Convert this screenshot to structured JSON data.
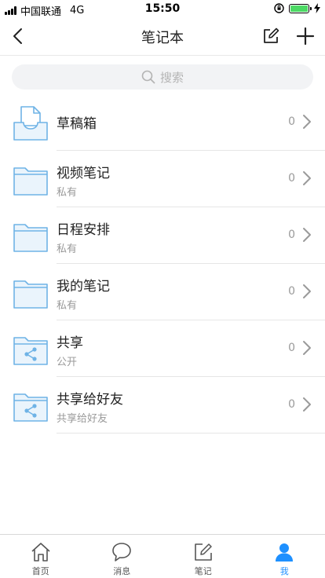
{
  "status_bar": {
    "carrier": "中国联通",
    "network": "4G",
    "time": "15:50"
  },
  "nav": {
    "title": "笔记本",
    "back_icon": "chevron-left-icon",
    "edit_icon": "edit-icon",
    "add_icon": "plus-icon"
  },
  "search": {
    "placeholder": "搜索"
  },
  "notebooks": [
    {
      "title": "草稿箱",
      "subtitle": "",
      "count": "0",
      "icon": "inbox-tray-icon"
    },
    {
      "title": "视频笔记",
      "subtitle": "私有",
      "count": "0",
      "icon": "folder-icon"
    },
    {
      "title": "日程安排",
      "subtitle": "私有",
      "count": "0",
      "icon": "folder-icon"
    },
    {
      "title": "我的笔记",
      "subtitle": "私有",
      "count": "0",
      "icon": "folder-icon"
    },
    {
      "title": "共享",
      "subtitle": "公开",
      "count": "0",
      "icon": "shared-folder-icon"
    },
    {
      "title": "共享给好友",
      "subtitle": "共享给好友",
      "count": "0",
      "icon": "shared-folder-icon"
    }
  ],
  "tabs": [
    {
      "label": "首页",
      "icon": "home-icon",
      "active": false
    },
    {
      "label": "消息",
      "icon": "message-icon",
      "active": false
    },
    {
      "label": "笔记",
      "icon": "note-icon",
      "active": false
    },
    {
      "label": "我",
      "icon": "user-icon",
      "active": true
    }
  ],
  "colors": {
    "accent": "#1e90ff",
    "folder_stroke": "#6fb3e6",
    "folder_fill": "#eaf4fc"
  }
}
